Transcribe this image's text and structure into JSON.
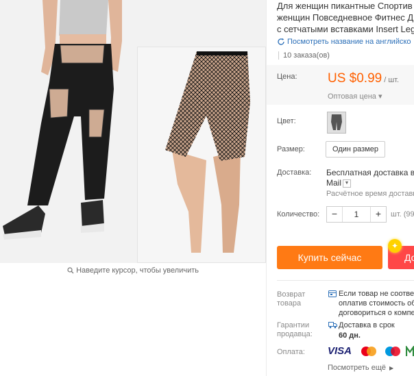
{
  "product": {
    "title_lines": [
      "Для женщин пикантные Спортив",
      "женщин Повседневное Фитнес Д",
      "с сетчатыми вставками Insert Leg"
    ],
    "translate_link": "Посмотреть название на английско",
    "orders": "10 заказа(ов)"
  },
  "gallery": {
    "zoom_hint": "Наведите курсор, чтобы увеличить"
  },
  "price": {
    "label": "Цена:",
    "value": "US $0.99",
    "unit": "/ шт.",
    "wholesale": "Оптовая цена ▾"
  },
  "color": {
    "label": "Цвет:"
  },
  "size": {
    "label": "Размер:",
    "option": "Один размер"
  },
  "shipping": {
    "label": "Доставка:",
    "line1": "Бесплатная доставка в R",
    "line2": "Mail",
    "line3": "Расчётное время доставки"
  },
  "quantity": {
    "label": "Количество:",
    "value": "1",
    "minus": "−",
    "plus": "+",
    "unit": "шт. (99"
  },
  "actions": {
    "buy_now": "Купить сейчас",
    "add_to_cart": "До"
  },
  "guarantees": {
    "return_label": "Возврат товара",
    "return_text": [
      "Если товар не соответ",
      "оплатив стоимость об",
      "договориться о компе"
    ],
    "guarantee_label": "Гарантии продавца:",
    "delivery_line1": "Доставка в срок",
    "delivery_line2": "60 дн.",
    "payment_label": "Оплата:",
    "visa": "VISA",
    "payment_more": "Посмотреть ещё"
  },
  "colors": {
    "price": "#ff6000",
    "buy": "#ff7a14",
    "cart": "#ff4747",
    "link": "#2b6fb8"
  }
}
